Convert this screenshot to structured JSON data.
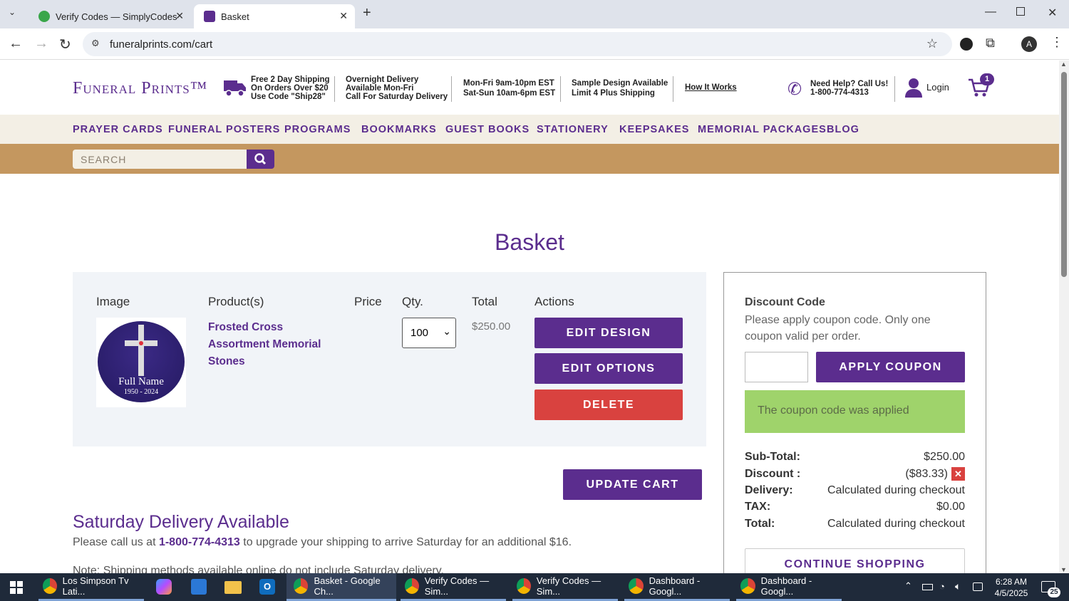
{
  "browser": {
    "tabs": [
      {
        "title": "Verify Codes — SimplyCodes",
        "active": false
      },
      {
        "title": "Basket",
        "active": true
      }
    ],
    "url": "funeralprints.com/cart",
    "profile_initial": "A"
  },
  "header": {
    "logo": "Funeral Prints™",
    "shipping_line1": "Free 2 Day Shipping",
    "shipping_line2": "On Orders Over $20",
    "shipping_line3": "Use Code \"Ship28\"",
    "overnight_line1": "Overnight Delivery",
    "overnight_line2": "Available Mon-Fri",
    "overnight_line3": "Call For Saturday Delivery",
    "hours_line1": "Mon-Fri 9am-10pm EST",
    "hours_line2": "Sat-Sun 10am-6pm EST",
    "sample_line1": "Sample Design Available",
    "sample_line2": "Limit 4 Plus Shipping",
    "how_it_works": "How It Works",
    "help_line1": "Need Help? Call Us!",
    "help_line2": "1-800-774-4313",
    "login": "Login",
    "cart_count": "1"
  },
  "menu": [
    "PRAYER CARDS",
    "FUNERAL POSTERS",
    "PROGRAMS",
    "BOOKMARKS",
    "GUEST BOOKS",
    "STATIONERY",
    "KEEPSAKES",
    "MEMORIAL PACKAGES",
    "BLOG"
  ],
  "search": {
    "placeholder": "SEARCH"
  },
  "page": {
    "title": "Basket"
  },
  "cart": {
    "columns": {
      "image": "Image",
      "product": "Product(s)",
      "price": "Price",
      "qty": "Qty.",
      "total": "Total",
      "actions": "Actions"
    },
    "item": {
      "name": "Frosted Cross Assortment Memorial Stones",
      "image_name": "Full Name",
      "image_years": "1950 - 2024",
      "qty": "100",
      "total": "$250.00"
    },
    "buttons": {
      "edit_design": "EDIT DESIGN",
      "edit_options": "EDIT OPTIONS",
      "delete": "DELETE",
      "update_cart": "UPDATE CART"
    }
  },
  "saturday": {
    "heading": "Saturday Delivery Available",
    "text_before": "Please call us at ",
    "phone": "1-800-774-4313",
    "text_after": " to upgrade your shipping to arrive Saturday for an additional $16.",
    "note": "Note: Shipping methods available online do not include Saturday delivery."
  },
  "summary": {
    "discount_title": "Discount Code",
    "discount_desc": "Please apply coupon code. Only one coupon valid per order.",
    "coupon_value": "",
    "apply_button": "APPLY COUPON",
    "applied_message": "The coupon code was applied",
    "rows": [
      {
        "label": "Sub-Total:",
        "value": "$250.00"
      },
      {
        "label": "Discount :",
        "value": "($83.33)"
      },
      {
        "label": "Delivery:",
        "value": "Calculated during checkout"
      },
      {
        "label": "TAX:",
        "value": "$0.00"
      },
      {
        "label": "Total:",
        "value": "Calculated during checkout"
      }
    ],
    "continue_button": "CONTINUE SHOPPING"
  },
  "taskbar": {
    "apps": [
      {
        "label": "Los Simpson Tv Lati..."
      },
      {
        "label": "Basket - Google Ch..."
      },
      {
        "label": "Verify Codes — Sim..."
      },
      {
        "label": "Verify Codes — Sim..."
      },
      {
        "label": "Dashboard - Googl..."
      },
      {
        "label": "Dashboard - Googl..."
      }
    ],
    "time": "6:28 AM",
    "date": "4/5/2025",
    "notification_count": "25"
  },
  "colors": {
    "brand_purple": "#5b2d8e",
    "tan": "#c4975f",
    "delete_red": "#d9423f",
    "success_green": "#9fd36b"
  }
}
